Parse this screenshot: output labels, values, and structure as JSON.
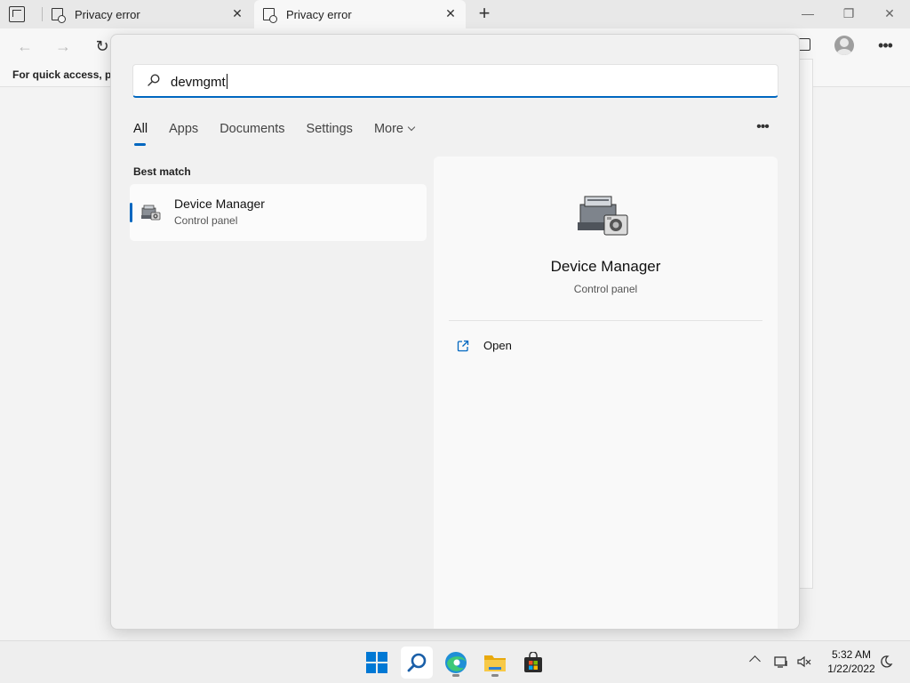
{
  "browser": {
    "tabs": [
      {
        "title": "Privacy error",
        "active": false
      },
      {
        "title": "Privacy error",
        "active": true
      }
    ],
    "favorites_bar_text": "For quick access, pla"
  },
  "search": {
    "query": "devmgmt",
    "filters": [
      {
        "label": "All",
        "active": true
      },
      {
        "label": "Apps",
        "active": false
      },
      {
        "label": "Documents",
        "active": false
      },
      {
        "label": "Settings",
        "active": false
      },
      {
        "label": "More",
        "active": false
      }
    ],
    "best_match_label": "Best match",
    "best_match": {
      "name": "Device Manager",
      "type": "Control panel"
    },
    "detail": {
      "name": "Device Manager",
      "type": "Control panel",
      "actions": [
        {
          "label": "Open",
          "icon": "open-external-icon"
        }
      ]
    }
  },
  "taskbar": {
    "apps": [
      "start-icon",
      "search-icon",
      "edge-icon",
      "file-explorer-icon",
      "store-icon"
    ],
    "clock": {
      "time": "5:32 AM",
      "date": "1/22/2022"
    }
  },
  "colors": {
    "accent": "#0067c0"
  }
}
